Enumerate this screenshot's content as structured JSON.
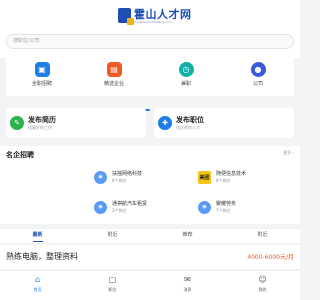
{
  "header": {
    "brand": "霍山人才网",
    "brand_sub": "huoshanrencaiwang.com",
    "search_placeholder": "搜职位/公司"
  },
  "quick_entries": [
    {
      "label": "全职招聘",
      "icon": "briefcase-icon",
      "color": "#1d7fe6"
    },
    {
      "label": "精选企业",
      "icon": "building-icon",
      "color": "#f05a24"
    },
    {
      "label": "兼职",
      "icon": "clock-icon",
      "color": "#14b0a5"
    },
    {
      "label": "公司",
      "icon": "person-icon",
      "color": "#3a5bd9"
    }
  ],
  "post_cards": [
    {
      "title": "发布简历",
      "subtitle": "找最好的工作",
      "icon": "resume-icon",
      "color": "#2bb24c"
    },
    {
      "title": "发布职位",
      "subtitle": "找优秀的人才",
      "icon": "post-job-icon",
      "color": "#1d7fe6"
    }
  ],
  "famous": {
    "title": "名企招聘",
    "more": "更多 ›",
    "companies": [
      {
        "name": "扶摇网络科技",
        "count": "8个岗位",
        "logo": "location-pin-icon",
        "logo_text": "",
        "color": "#5b9bf5"
      },
      {
        "name": "随便信息技术",
        "count": "8个岗位",
        "logo": "meituan-logo",
        "logo_text": "美团",
        "color": "#f5c518"
      },
      {
        "name": "通祺航汽车租赁",
        "count": "3个岗位",
        "logo": "location-pin-icon",
        "logo_text": "",
        "color": "#5b9bf5"
      },
      {
        "name": "聚耀劳务",
        "count": "7个岗位",
        "logo": "location-pin-icon",
        "logo_text": "",
        "color": "#5b9bf5"
      }
    ]
  },
  "tabs": [
    "最新",
    "附近",
    "推荐",
    "附近"
  ],
  "active_tab": 0,
  "job": {
    "title": "熟练电脑，整理资料",
    "salary": "4000-6000元/月"
  },
  "bottom_nav": [
    {
      "label": "首页",
      "icon": "home-icon"
    },
    {
      "label": "职位",
      "icon": "job-bag-icon"
    },
    {
      "label": "消息",
      "icon": "message-icon"
    },
    {
      "label": "我的",
      "icon": "profile-icon"
    }
  ]
}
